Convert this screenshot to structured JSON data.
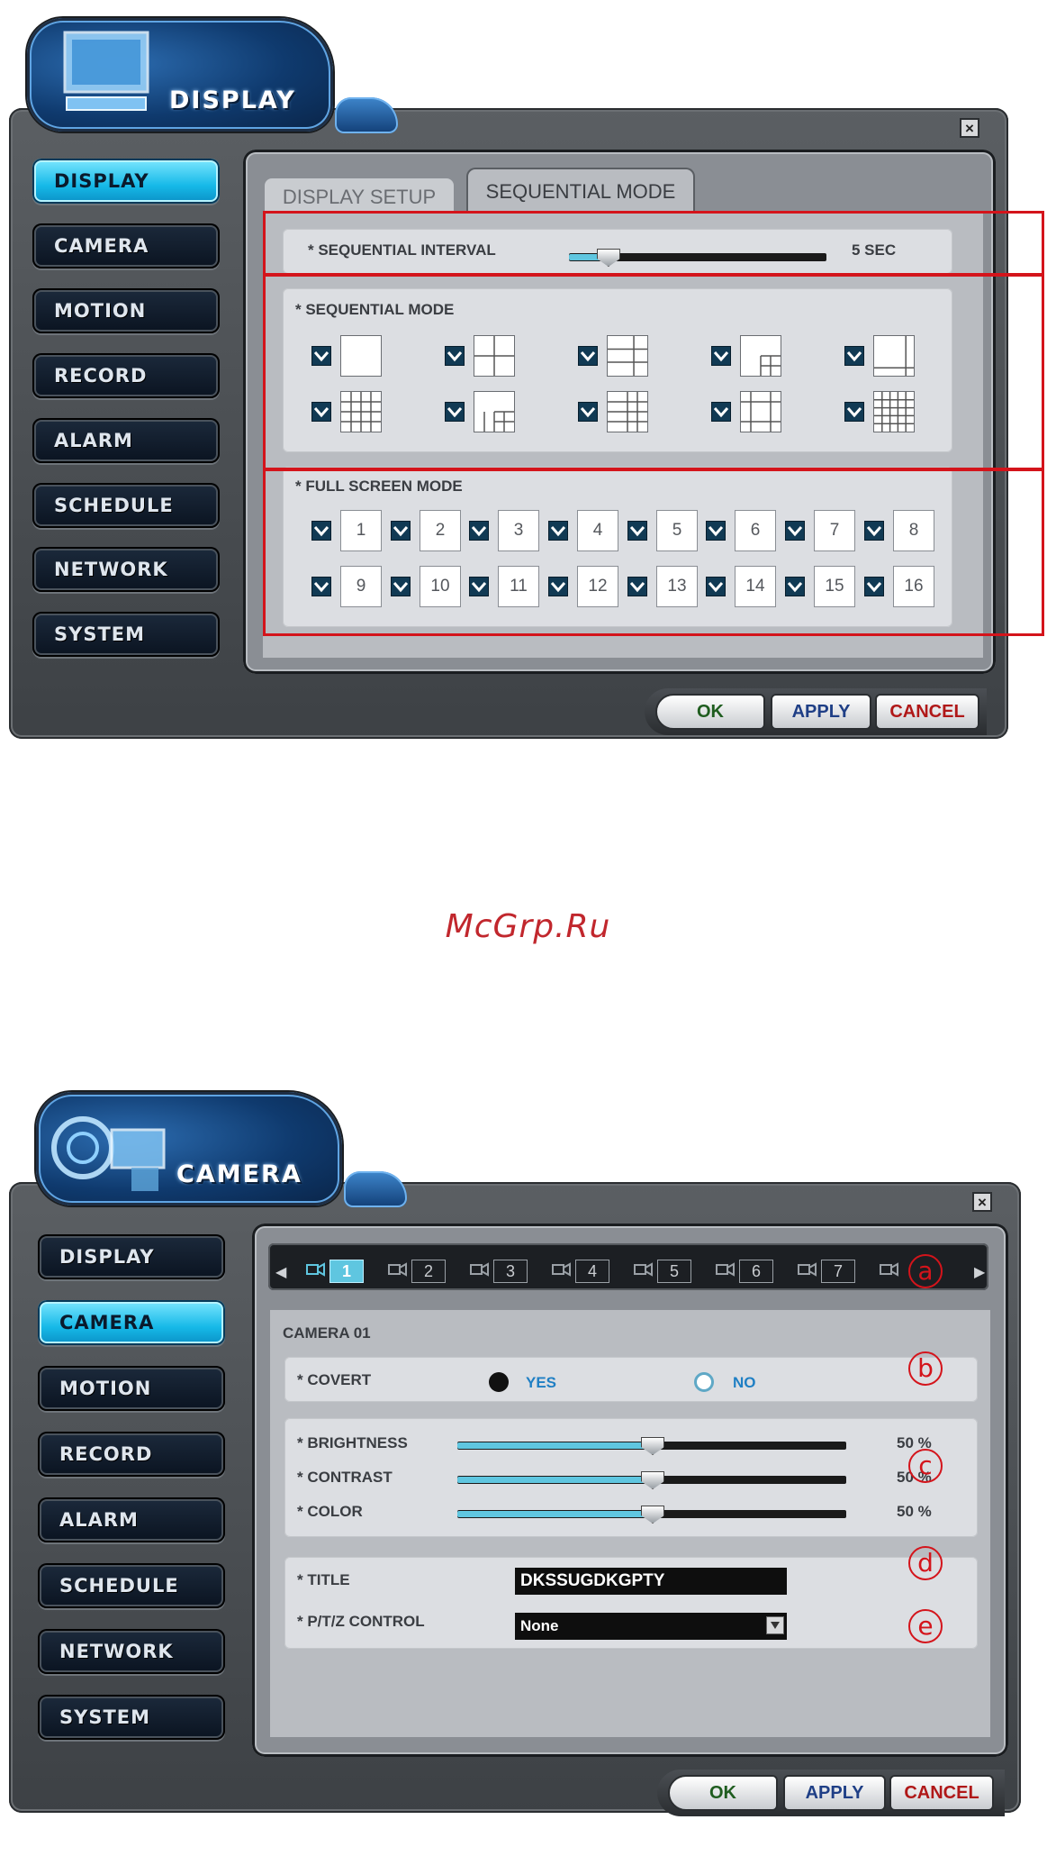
{
  "display_window": {
    "title": "DISPLAY",
    "close": "×",
    "sidebar": [
      {
        "label": "DISPLAY",
        "active": true
      },
      {
        "label": "CAMERA",
        "active": false
      },
      {
        "label": "MOTION",
        "active": false
      },
      {
        "label": "RECORD",
        "active": false
      },
      {
        "label": "ALARM",
        "active": false
      },
      {
        "label": "SCHEDULE",
        "active": false
      },
      {
        "label": "NETWORK",
        "active": false
      },
      {
        "label": "SYSTEM",
        "active": false
      }
    ],
    "tabs": {
      "display_setup": "DISPLAY SETUP",
      "sequential_mode": "SEQUENTIAL MODE"
    },
    "sequential_interval": {
      "label": "* SEQUENTIAL INTERVAL",
      "value": "5 SEC",
      "level": 0.15
    },
    "sequential_mode": {
      "label": "* SEQUENTIAL MODE"
    },
    "full_screen_mode": {
      "label": "* FULL SCREEN MODE",
      "row1": [
        "1",
        "2",
        "3",
        "4",
        "5",
        "6",
        "7",
        "8"
      ],
      "row2": [
        "9",
        "10",
        "11",
        "12",
        "13",
        "14",
        "15",
        "16"
      ]
    },
    "buttons": {
      "ok": "OK",
      "apply": "APPLY",
      "cancel": "CANCEL"
    }
  },
  "watermark": "McGrp.Ru",
  "camera_window": {
    "title": "CAMERA",
    "close": "×",
    "sidebar": [
      {
        "label": "DISPLAY",
        "active": false
      },
      {
        "label": "CAMERA",
        "active": true
      },
      {
        "label": "MOTION",
        "active": false
      },
      {
        "label": "RECORD",
        "active": false
      },
      {
        "label": "ALARM",
        "active": false
      },
      {
        "label": "SCHEDULE",
        "active": false
      },
      {
        "label": "NETWORK",
        "active": false
      },
      {
        "label": "SYSTEM",
        "active": false
      }
    ],
    "cameras": [
      "1",
      "2",
      "3",
      "4",
      "5",
      "6",
      "7"
    ],
    "heading": "CAMERA 01",
    "covert": {
      "label": "* COVERT",
      "yes": "YES",
      "no": "NO"
    },
    "brightness": {
      "label": "* BRIGHTNESS",
      "value": "50 %",
      "level": 0.5
    },
    "contrast": {
      "label": "* CONTRAST",
      "value": "50 %",
      "level": 0.5
    },
    "color": {
      "label": "* COLOR",
      "value": "50 %",
      "level": 0.5
    },
    "title_field": {
      "label": "* TITLE",
      "value": "DKSSUGDKGPTY"
    },
    "ptz": {
      "label": "* P/T/Z CONTROL",
      "value": "None"
    },
    "callouts": [
      "a",
      "b",
      "c",
      "d",
      "e"
    ],
    "buttons": {
      "ok": "OK",
      "apply": "APPLY",
      "cancel": "CANCEL"
    }
  }
}
